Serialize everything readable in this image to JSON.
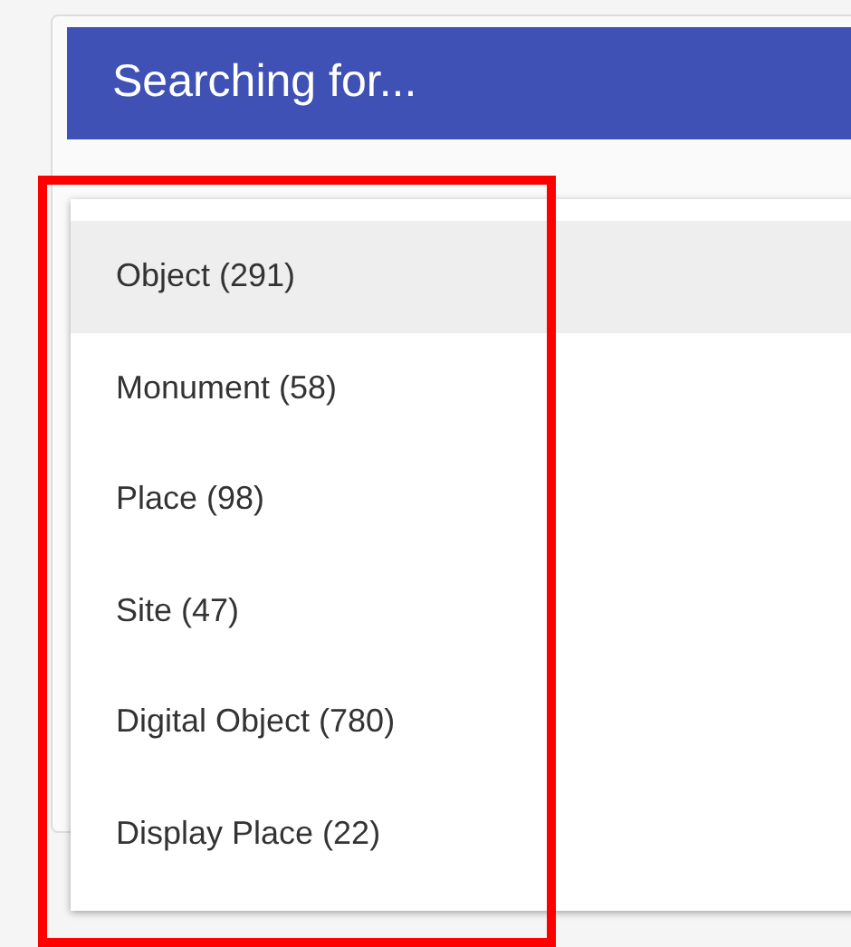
{
  "card": {
    "title": "Searching for..."
  },
  "dropdown": {
    "items": [
      {
        "label": "Object (291)",
        "selected": true
      },
      {
        "label": "Monument (58)",
        "selected": false
      },
      {
        "label": "Place (98)",
        "selected": false
      },
      {
        "label": "Site (47)",
        "selected": false
      },
      {
        "label": "Digital Object (780)",
        "selected": false
      },
      {
        "label": "Display Place (22)",
        "selected": false
      }
    ]
  }
}
